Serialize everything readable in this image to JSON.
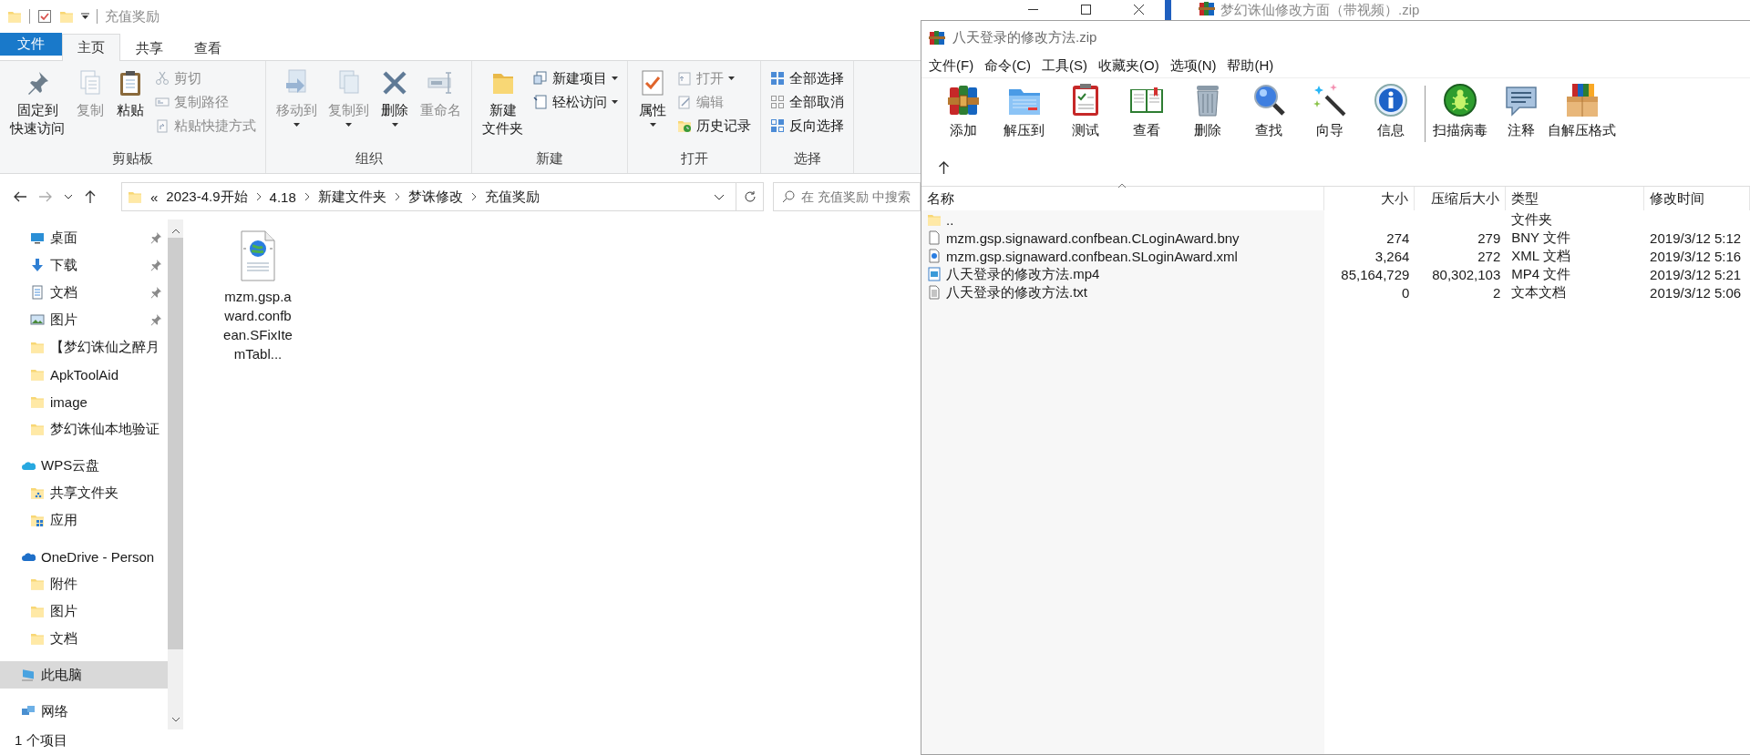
{
  "explorer": {
    "title": "充值奖励",
    "tabs": [
      {
        "label": "文件",
        "kind": "file",
        "selected": false
      },
      {
        "label": "主页",
        "kind": "tab",
        "selected": true
      },
      {
        "label": "共享",
        "kind": "tab",
        "selected": false
      },
      {
        "label": "查看",
        "kind": "tab",
        "selected": false
      }
    ],
    "ribbon": {
      "groups": [
        {
          "label": "剪贴板",
          "buttons": [
            {
              "lines": [
                "固定到",
                "快速访问"
              ],
              "kind": "large",
              "disabled": false,
              "dropdown": false
            },
            {
              "label": "复制",
              "kind": "large",
              "disabled": true,
              "dropdown": false
            },
            {
              "label": "粘贴",
              "kind": "large",
              "disabled": false,
              "dropdown": false
            },
            {
              "label": "剪切",
              "kind": "small",
              "disabled": true,
              "dropdown": false
            },
            {
              "label": "复制路径",
              "kind": "small",
              "disabled": true,
              "dropdown": false
            },
            {
              "label": "粘贴快捷方式",
              "kind": "small",
              "disabled": true,
              "dropdown": false
            }
          ]
        },
        {
          "label": "组织",
          "buttons": [
            {
              "label": "移动到",
              "kind": "large",
              "disabled": true,
              "dropdown": true
            },
            {
              "label": "复制到",
              "kind": "large",
              "disabled": true,
              "dropdown": true
            },
            {
              "label": "删除",
              "kind": "large",
              "disabled": false,
              "dropdown": true
            },
            {
              "label": "重命名",
              "kind": "large",
              "disabled": true,
              "dropdown": false
            }
          ]
        },
        {
          "label": "新建",
          "buttons": [
            {
              "lines": [
                "新建",
                "文件夹"
              ],
              "kind": "large",
              "disabled": false,
              "dropdown": false
            },
            {
              "label": "新建项目",
              "kind": "small",
              "disabled": false,
              "dropdown": true
            },
            {
              "label": "轻松访问",
              "kind": "small",
              "disabled": false,
              "dropdown": true
            }
          ]
        },
        {
          "label": "打开",
          "buttons": [
            {
              "label": "属性",
              "kind": "large",
              "disabled": false,
              "dropdown": true
            },
            {
              "label": "打开",
              "kind": "small",
              "disabled": true,
              "dropdown": true
            },
            {
              "label": "编辑",
              "kind": "small",
              "disabled": true,
              "dropdown": false
            },
            {
              "label": "历史记录",
              "kind": "small",
              "disabled": false,
              "dropdown": false
            }
          ]
        },
        {
          "label": "选择",
          "buttons": [
            {
              "label": "全部选择",
              "kind": "small",
              "disabled": false,
              "dropdown": false
            },
            {
              "label": "全部取消",
              "kind": "small",
              "disabled": false,
              "dropdown": false
            },
            {
              "label": "反向选择",
              "kind": "small",
              "disabled": false,
              "dropdown": false
            }
          ]
        }
      ]
    },
    "address": {
      "overflow": "«",
      "crumbs": [
        "2023-4.9开始",
        "4.18",
        "新建文件夹",
        "梦诛修改",
        "充值奖励"
      ],
      "search_placeholder": "在 充值奖励 中搜索"
    },
    "sidebar": {
      "quick_access": [
        {
          "label": "桌面",
          "pinned": true,
          "selected": false
        },
        {
          "label": "下载",
          "pinned": true,
          "selected": false
        },
        {
          "label": "文档",
          "pinned": true,
          "selected": false
        },
        {
          "label": "图片",
          "pinned": true,
          "selected": false
        },
        {
          "label": "【梦幻诛仙之醉月",
          "pinned": false,
          "selected": false
        },
        {
          "label": "ApkToolAid",
          "pinned": false,
          "selected": false
        },
        {
          "label": "image",
          "pinned": false,
          "selected": false
        },
        {
          "label": "梦幻诛仙本地验证",
          "pinned": false,
          "selected": false
        }
      ],
      "tree": [
        {
          "label": "WPS云盘",
          "selected": false,
          "children": [
            {
              "label": "共享文件夹",
              "selected": false
            },
            {
              "label": "应用",
              "selected": false
            }
          ]
        },
        {
          "label": "OneDrive - Person",
          "selected": false,
          "children": [
            {
              "label": "附件",
              "selected": false
            },
            {
              "label": "图片",
              "selected": false
            },
            {
              "label": "文档",
              "selected": false
            }
          ]
        },
        {
          "label": "此电脑",
          "selected": true
        },
        {
          "label": "网络",
          "selected": false
        }
      ]
    },
    "files": [
      {
        "name": "mzm.gsp.award.confbean.SFixItemTabl..."
      }
    ],
    "status": "1 个项目"
  },
  "background_window": {
    "title": "梦幻诛仙修改方面（带视频）.zip"
  },
  "winrar": {
    "title": "八天登录的修改方法.zip",
    "menu": [
      "文件(F)",
      "命令(C)",
      "工具(S)",
      "收藏夹(O)",
      "选项(N)",
      "帮助(H)"
    ],
    "toolbar_groups": [
      [
        "添加",
        "解压到",
        "测试",
        "查看",
        "删除",
        "查找",
        "向导",
        "信息"
      ],
      [
        "扫描病毒",
        "注释",
        "自解压格式"
      ]
    ],
    "columns": [
      {
        "label": "名称",
        "sorted": true
      },
      {
        "label": "大小",
        "sorted": false
      },
      {
        "label": "压缩后大小",
        "sorted": false
      },
      {
        "label": "类型",
        "sorted": false
      },
      {
        "label": "修改时间",
        "sorted": false
      }
    ],
    "rows": [
      {
        "name": "..",
        "type": "文件夹"
      },
      {
        "name": "mzm.gsp.signaward.confbean.CLoginAward.bny",
        "size": "274",
        "packed": "279",
        "type": "BNY 文件",
        "modified": "2019/3/12 5:12"
      },
      {
        "name": "mzm.gsp.signaward.confbean.SLoginAward.xml",
        "size": "3,264",
        "packed": "272",
        "type": "XML 文档",
        "modified": "2019/3/12 5:16"
      },
      {
        "name": "八天登录的修改方法.mp4",
        "size": "85,164,729",
        "packed": "80,302,103",
        "type": "MP4 文件",
        "modified": "2019/3/12 5:21"
      },
      {
        "name": "八天登录的修改方法.txt",
        "size": "0",
        "packed": "2",
        "type": "文本文档",
        "modified": "2019/3/12 5:06"
      }
    ]
  }
}
